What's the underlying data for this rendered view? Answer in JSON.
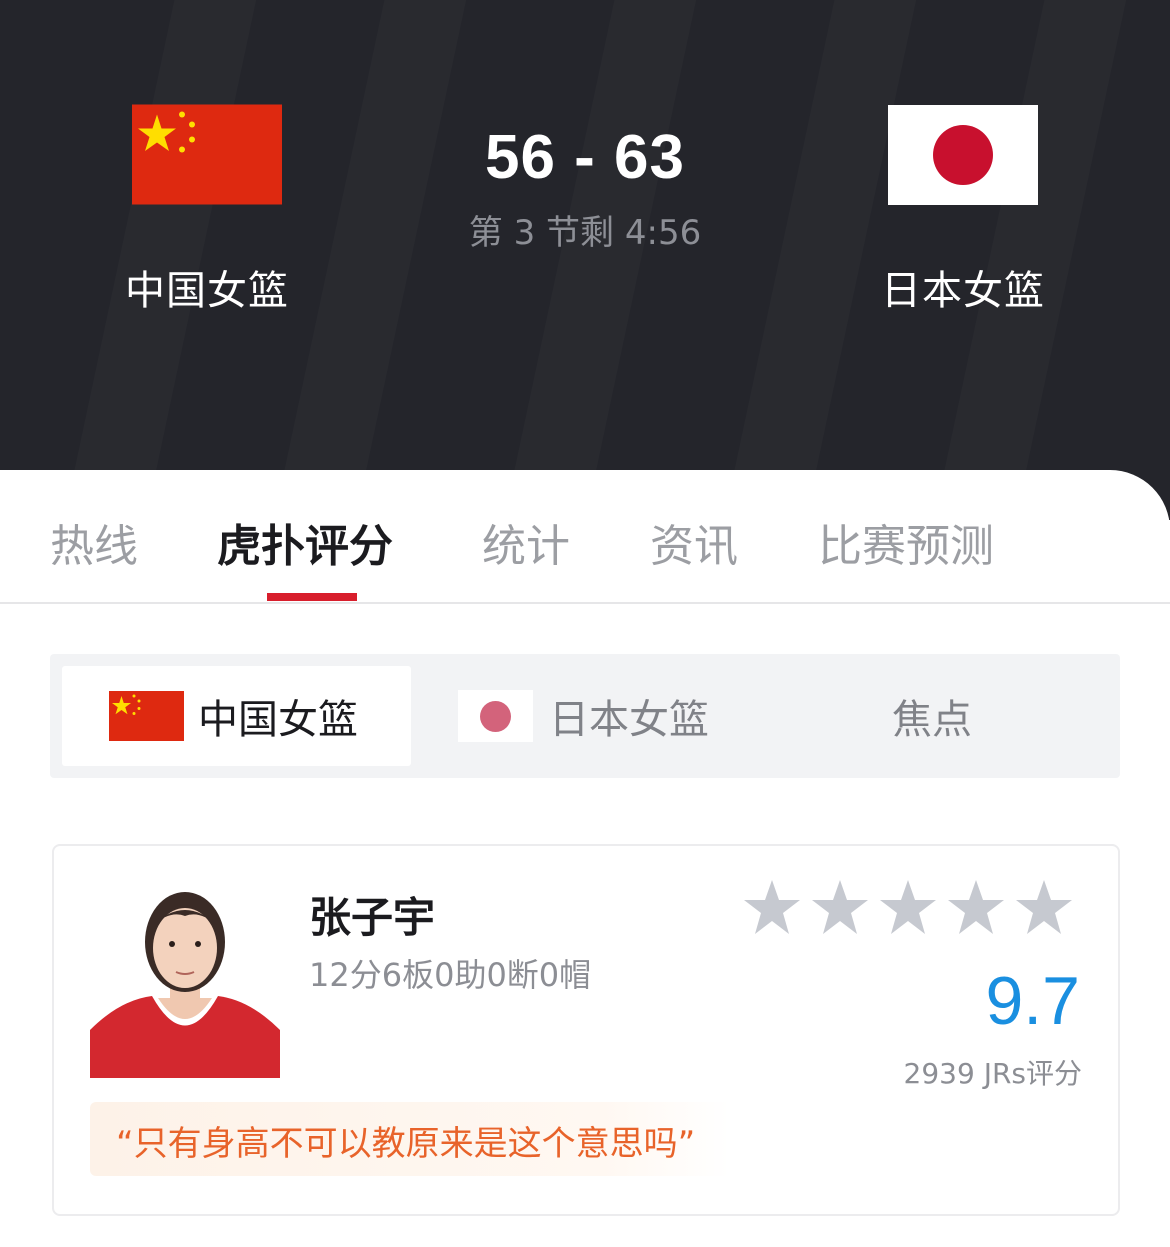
{
  "match": {
    "home_team": "中国女篮",
    "away_team": "日本女篮",
    "score": "56 - 63",
    "status": "第 3 节剩 4:56"
  },
  "tabs": [
    {
      "label": "热线"
    },
    {
      "label": "虎扑评分",
      "active": true
    },
    {
      "label": "统计"
    },
    {
      "label": "资讯"
    },
    {
      "label": "比赛预测"
    }
  ],
  "segments": [
    {
      "label": "中国女篮",
      "active": true
    },
    {
      "label": "日本女篮"
    },
    {
      "label": "焦点"
    }
  ],
  "player": {
    "name": "张子宇",
    "stats": "12分6板0助0断0帽",
    "rating": "9.7",
    "votes": "2939 JRs评分",
    "stars_filled": 0,
    "stars_total": 5,
    "comment": "“只有身高不可以教原来是这个意思吗”"
  },
  "colors": {
    "header_bg": "#24252b",
    "tab_underline": "#d81e2c",
    "rating": "#1a8fe0",
    "comment_text": "#e8632a",
    "star_empty": "#c6c9d0"
  },
  "icons": [
    "china-flag-icon",
    "japan-flag-icon",
    "star-icon"
  ]
}
